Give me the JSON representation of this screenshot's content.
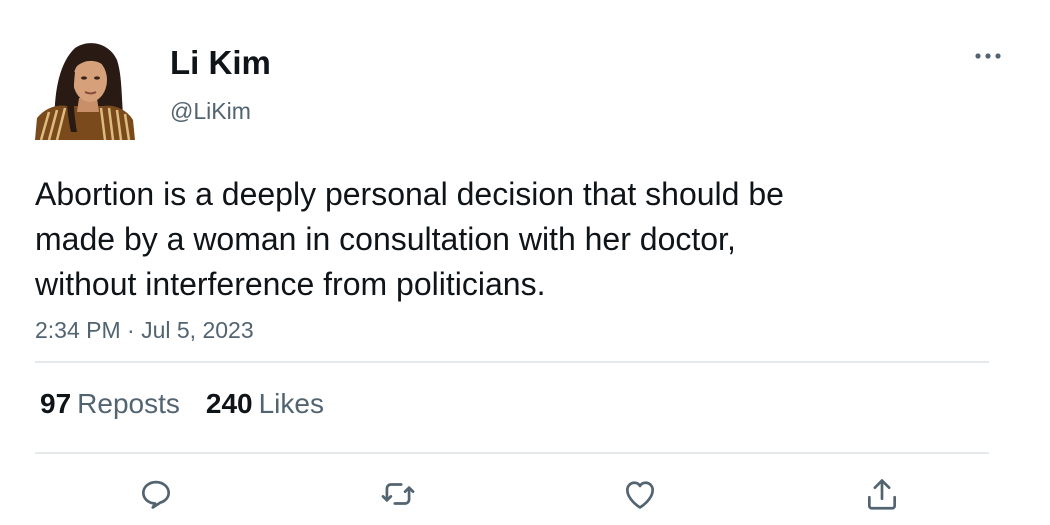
{
  "author": {
    "name": "Li Kim",
    "handle": "@LiKim",
    "avatar_icon": "profile-photo"
  },
  "tweet": {
    "lines": [
      "Abortion is a deeply personal decision that should be",
      "made by a woman in consultation with her doctor,",
      "without interference from politicians."
    ],
    "timestamp": "2:34 PM · Jul 5, 2023"
  },
  "stats": {
    "reposts_count": "97",
    "reposts_label": "Reposts",
    "likes_count": "240",
    "likes_label": "Likes"
  },
  "actions": [
    {
      "icon": "reply-icon"
    },
    {
      "icon": "repost-icon"
    },
    {
      "icon": "like-icon"
    },
    {
      "icon": "share-icon"
    }
  ],
  "colors": {
    "text": "#0f1419",
    "secondary": "#536471",
    "divider": "#e6e9eb"
  }
}
